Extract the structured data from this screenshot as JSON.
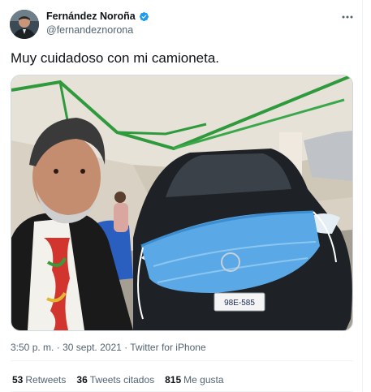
{
  "author": {
    "display_name": "Fernández Noroña",
    "handle": "@fernandeznorona",
    "verified": true,
    "avatar_icon": "user-avatar"
  },
  "tweet": {
    "text": "Muy cuidadoso con mi camioneta.",
    "media_icon": "photo-selfie-masked-car",
    "time": "3:50 p. m.",
    "separator": "·",
    "date": "30 sept. 2021",
    "source": "Twitter for iPhone",
    "plate_text": "98E-585"
  },
  "stats": {
    "retweets_count": "53",
    "retweets_label": "Retweets",
    "quotes_count": "36",
    "quotes_label": "Tweets citados",
    "likes_count": "815",
    "likes_label": "Me gusta"
  },
  "colors": {
    "verified_blue": "#1d9bf0",
    "secondary_text": "#536471",
    "primary_text": "#0f1419"
  }
}
